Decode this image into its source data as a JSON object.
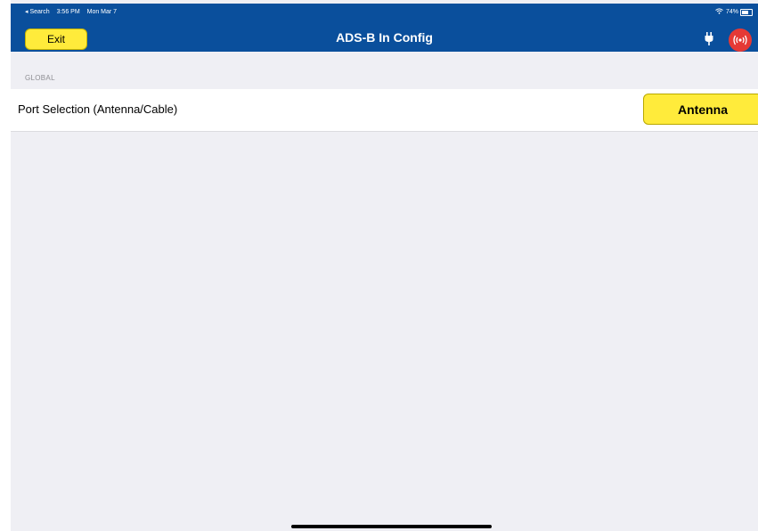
{
  "status_bar": {
    "back_label": "◂ Search",
    "time": "3:56 PM",
    "date": "Mon Mar 7",
    "battery": "74%",
    "battery_level": 0.74
  },
  "nav": {
    "exit_label": "Exit",
    "title": "ADS-B In Config",
    "icons": [
      "plug-icon",
      "radio-broadcast-icon"
    ]
  },
  "section": {
    "header": "GLOBAL"
  },
  "row": {
    "label": "Port Selection (Antenna/Cable)",
    "value": "Antenna"
  },
  "colors": {
    "nav_background": "#0a4f9c",
    "button_yellow": "#ffeb3b",
    "alert_red": "#e53935",
    "page_background": "#efeff4"
  }
}
